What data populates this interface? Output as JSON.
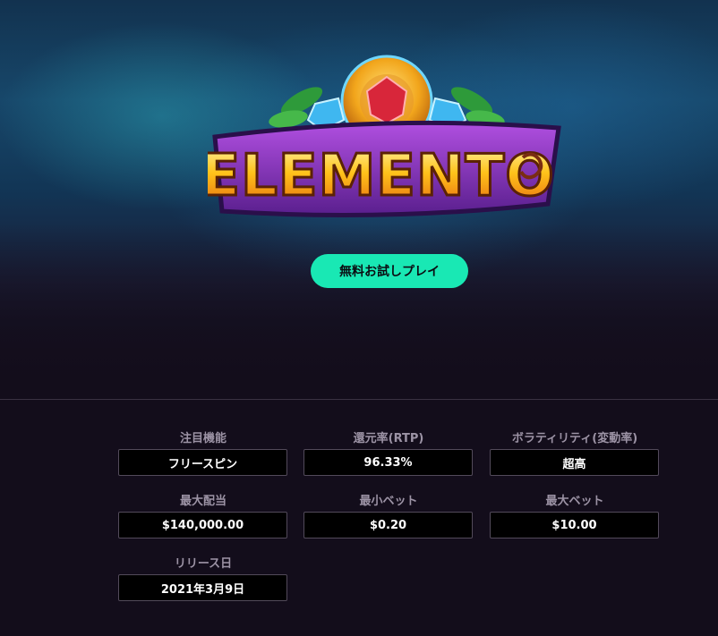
{
  "game": {
    "logo_text": "ELEMENTO",
    "play_button_label": "無料お試しプレイ"
  },
  "stats": [
    {
      "label": "注目機能",
      "value": "フリースピン"
    },
    {
      "label": "還元率(RTP)",
      "value": "96.33%"
    },
    {
      "label": "ボラティリティ(変動率)",
      "value": "超高"
    },
    {
      "label": "最大配当",
      "value": "$140,000.00"
    },
    {
      "label": "最小ベット",
      "value": "$0.20"
    },
    {
      "label": "最大ベット",
      "value": "$10.00"
    },
    {
      "label": "リリース日",
      "value": "2021年3月9日"
    }
  ],
  "colors": {
    "background": "#130d1b",
    "play_button": "#19e8b4",
    "value_box": "#000000",
    "label_text": "#9c93a5"
  }
}
